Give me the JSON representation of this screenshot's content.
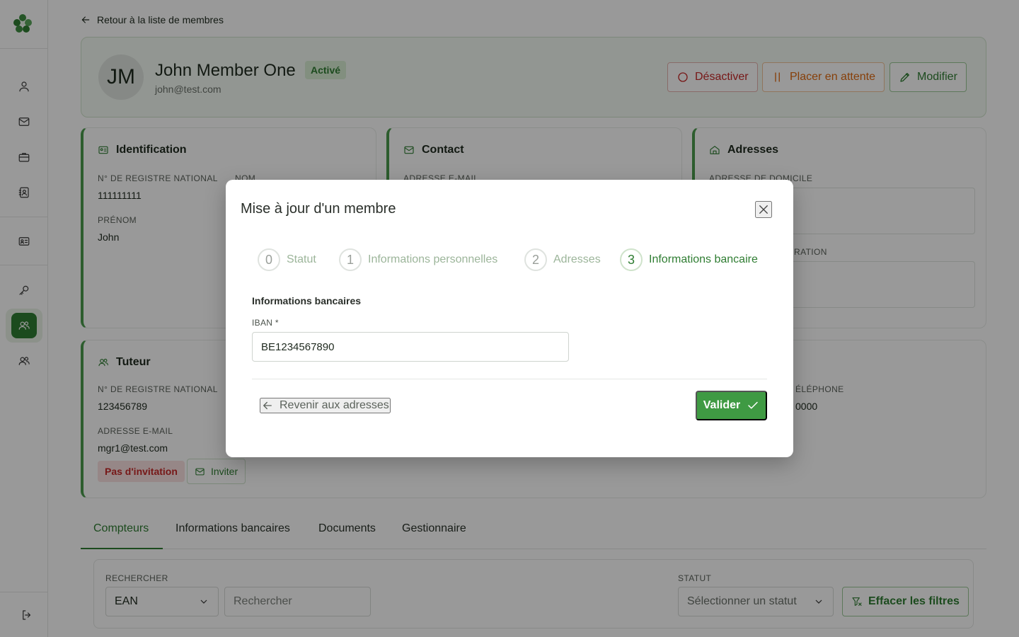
{
  "colors": {
    "accent": "#2f7d32",
    "danger": "#c62828",
    "warning": "#e06a10",
    "overlay": "rgba(0,0,0,0.40)"
  },
  "sidebar": {
    "logo_icon": "clover-logo",
    "items": [
      {
        "icon": "user-icon"
      },
      {
        "icon": "mail-icon"
      },
      {
        "icon": "briefcase-icon"
      },
      {
        "icon": "contact-book-icon"
      },
      {
        "icon": "id-card-icon"
      },
      {
        "icon": "key-icon"
      },
      {
        "icon": "users-icon",
        "active": true
      },
      {
        "icon": "users-outline-icon"
      }
    ],
    "logout_icon": "logout-icon"
  },
  "back_link": {
    "label": "Retour à la liste de membres"
  },
  "header": {
    "initials": "JM",
    "name": "John Member One",
    "status": "Activé",
    "email": "john@test.com",
    "buttons": {
      "deactivate": "Désactiver",
      "hold": "Placer en attente",
      "edit": "Modifier"
    }
  },
  "cards": {
    "identification": {
      "title": "Identification",
      "national_register_label": "N° de registre national",
      "national_register_value": "111111111",
      "name_label": "Nom",
      "firstname_label": "Prénom",
      "firstname_value": "John"
    },
    "contact": {
      "title": "Contact",
      "email_label": "Adresse e-mail"
    },
    "addresses": {
      "title": "Adresses",
      "home_label": "Adresse de domicile",
      "second_label_partial": "RATION"
    },
    "tutor": {
      "title": "Tuteur",
      "national_register_label": "N° de registre national",
      "national_register_value": "123456789",
      "email_label": "Adresse e-mail",
      "email_value": "mgr1@test.com",
      "invite_status": "Pas d'invitation",
      "invite_button": "Inviter",
      "phone_label_partial": "ÉLÉPHONE",
      "phone_value_partial": "0000"
    }
  },
  "tabs": [
    {
      "label": "Compteurs",
      "active": true
    },
    {
      "label": "Informations bancaires"
    },
    {
      "label": "Documents"
    },
    {
      "label": "Gestionnaire"
    }
  ],
  "filters": {
    "search_label": "Rechercher",
    "search_type": "EAN",
    "search_placeholder": "Rechercher",
    "status_label": "Statut",
    "status_placeholder": "Sélectionner un statut",
    "clear_button": "Effacer les filtres"
  },
  "modal": {
    "title": "Mise à jour d'un membre",
    "steps": [
      {
        "num": "0",
        "label": "Statut"
      },
      {
        "num": "1",
        "label": "Informations personnelles"
      },
      {
        "num": "2",
        "label": "Adresses"
      },
      {
        "num": "3",
        "label": "Informations bancaire",
        "current": true
      }
    ],
    "section_label": "Informations bancaires",
    "iban_label": "IBAN *",
    "iban_value": "BE1234567890",
    "back_button": "Revenir aux adresses",
    "submit_button": "Valider"
  }
}
